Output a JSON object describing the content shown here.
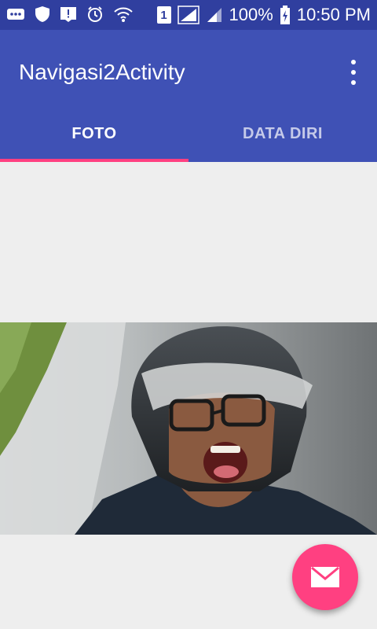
{
  "status_bar": {
    "battery_text": "100%",
    "time": "10:50 PM",
    "sim_label": "1",
    "icons": [
      "more-notifications-icon",
      "shield-icon",
      "download-alert-icon",
      "alarm-icon",
      "wifi-icon",
      "sim-icon",
      "signal-icon",
      "signal-icon-2",
      "battery-charging-icon"
    ]
  },
  "app_bar": {
    "title": "Navigasi2Activity",
    "overflow_icon": "more-vert-icon"
  },
  "tabs": [
    {
      "label": "FOTO",
      "active": true
    },
    {
      "label": "DATA DIRI",
      "active": false
    }
  ],
  "fab": {
    "icon": "email-icon",
    "color": "#ff4081"
  },
  "colors": {
    "primary": "#3f51b5",
    "primary_dark": "#303f9f",
    "accent": "#ff4081",
    "background": "#eeeeee"
  }
}
